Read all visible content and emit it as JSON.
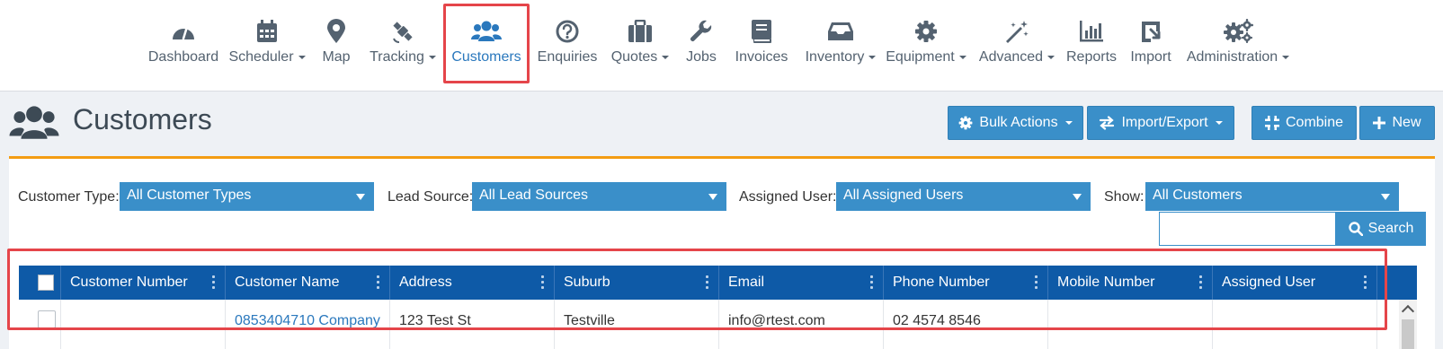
{
  "nav": {
    "items": [
      {
        "label": "Dashboard",
        "icon": "gauge-icon"
      },
      {
        "label": "Scheduler",
        "icon": "calendar-icon",
        "dropdown": true
      },
      {
        "label": "Map",
        "icon": "map-pin-icon"
      },
      {
        "label": "Tracking",
        "icon": "satellite-icon",
        "dropdown": true
      },
      {
        "label": "Customers",
        "icon": "users-icon",
        "active": true
      },
      {
        "label": "Enquiries",
        "icon": "question-circle-icon"
      },
      {
        "label": "Quotes",
        "icon": "briefcase-icon",
        "dropdown": true
      },
      {
        "label": "Jobs",
        "icon": "wrench-icon"
      },
      {
        "label": "Invoices",
        "icon": "book-icon"
      },
      {
        "label": "Inventory",
        "icon": "inbox-icon",
        "dropdown": true
      },
      {
        "label": "Equipment",
        "icon": "cog-icon",
        "dropdown": true
      },
      {
        "label": "Advanced",
        "icon": "magic-wand-icon",
        "dropdown": true
      },
      {
        "label": "Reports",
        "icon": "bar-chart-icon"
      },
      {
        "label": "Import",
        "icon": "import-icon"
      },
      {
        "label": "Administration",
        "icon": "cogs-icon",
        "dropdown": true
      }
    ]
  },
  "page": {
    "title": "Customers",
    "buttons": {
      "bulk_actions": "Bulk Actions",
      "import_export": "Import/Export",
      "combine": "Combine",
      "new": "New"
    }
  },
  "filters": {
    "customer_type": {
      "label": "Customer Type:",
      "value": "All Customer Types"
    },
    "lead_source": {
      "label": "Lead Source:",
      "value": "All Lead Sources"
    },
    "assigned_user": {
      "label": "Assigned User:",
      "value": "All Assigned Users"
    },
    "show": {
      "label": "Show:",
      "value": "All Customers"
    },
    "search_value": "",
    "search_label": "Search"
  },
  "grid": {
    "columns": [
      "Customer Number",
      "Customer Name",
      "Address",
      "Suburb",
      "Email",
      "Phone Number",
      "Mobile Number",
      "Assigned User"
    ],
    "rows": [
      {
        "customer_number": "",
        "customer_name": "0853404710 Company",
        "address": "123 Test St",
        "suburb": "Testville",
        "email": "info@rtest.com",
        "phone_number": "02 4574 8546",
        "mobile_number": "",
        "assigned_user": ""
      }
    ]
  },
  "colors": {
    "accent": "#3a8fc9",
    "grid_header": "#0e5aa7",
    "highlight": "#e5454a",
    "active_nav": "#2a78bd",
    "panel_top": "#f39c12"
  }
}
